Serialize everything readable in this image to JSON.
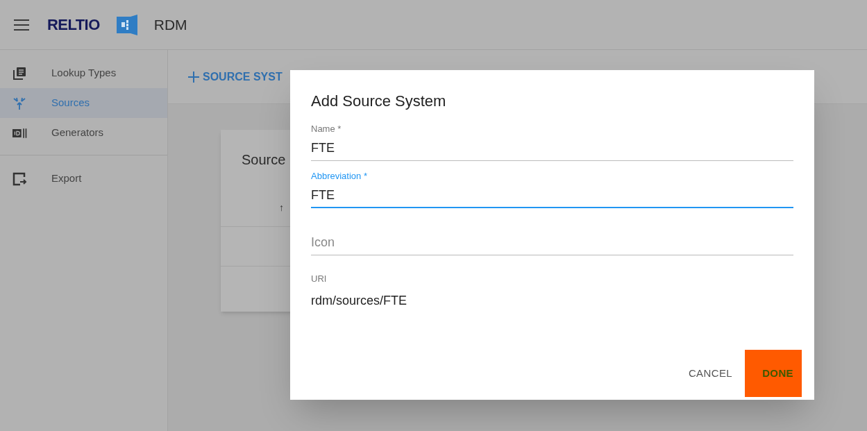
{
  "header": {
    "logo": "RELTIO",
    "app": "RDM"
  },
  "sidebar": {
    "groups": [
      [
        {
          "label": "Lookup Types",
          "selected": false
        },
        {
          "label": "Sources",
          "selected": true
        },
        {
          "label": "Generators",
          "selected": false
        }
      ],
      [
        {
          "label": "Export",
          "selected": false
        }
      ]
    ]
  },
  "toolbar": {
    "add_button": "SOURCE SYST"
  },
  "card": {
    "title": "Source",
    "sort_icon": "↑"
  },
  "dialog": {
    "title": "Add Source System",
    "fields": [
      {
        "kind": "input",
        "label": "Name *",
        "value": "FTE",
        "focused": false
      },
      {
        "kind": "input",
        "label": "Abbreviation *",
        "value": "FTE",
        "focused": true
      },
      {
        "kind": "input",
        "placeholder": "Icon",
        "focused": false
      },
      {
        "kind": "readonly",
        "label": "URI",
        "value": "rdm/sources/FTE"
      }
    ],
    "buttons": [
      {
        "label": "CANCEL",
        "kind": "text"
      },
      {
        "label": "DONE",
        "kind": "highlight"
      }
    ]
  }
}
